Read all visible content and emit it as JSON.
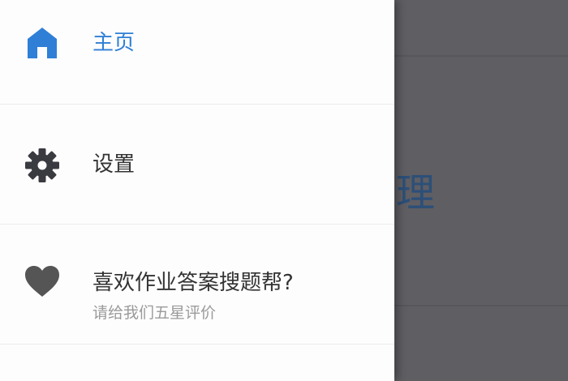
{
  "drawer": {
    "items": [
      {
        "label": "主页",
        "icon": "home-icon",
        "active": true
      },
      {
        "label": "设置",
        "icon": "gear-icon"
      },
      {
        "label": "喜欢作业答案搜题帮?",
        "sublabel": "请给我们五星评价",
        "icon": "heart-icon"
      }
    ]
  },
  "background": {
    "subject_text": "物理"
  },
  "colors": {
    "accent": "#2f7fd6",
    "icon_dark": "#3a3b40",
    "icon_heart": "#555555",
    "overlay": "#5f5e63",
    "subject_text": "#2c4f78"
  }
}
